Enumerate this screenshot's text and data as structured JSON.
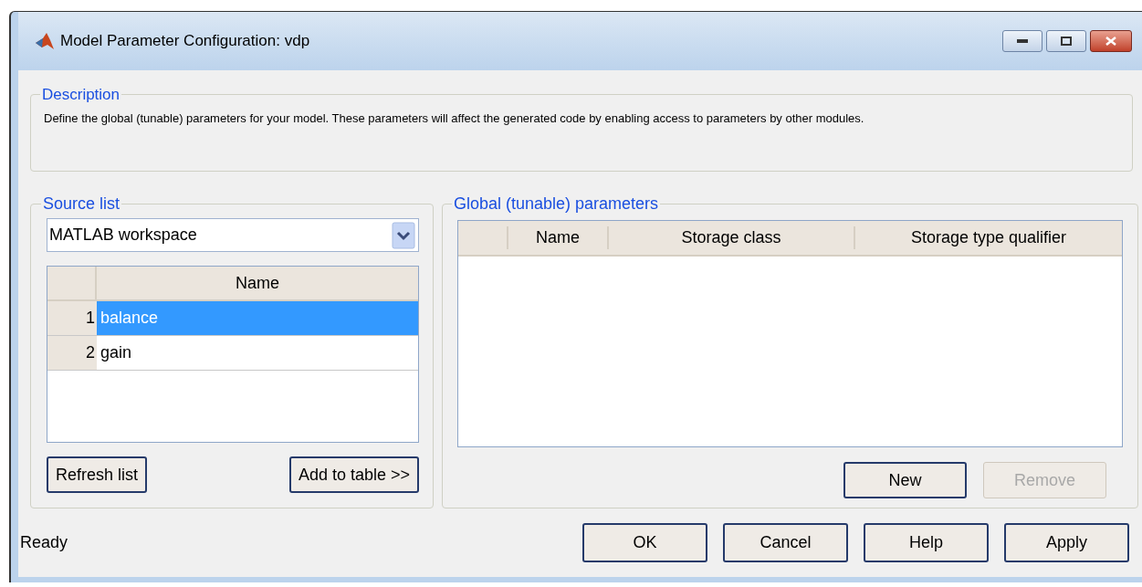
{
  "window": {
    "title": "Model Parameter Configuration: vdp"
  },
  "description": {
    "title": "Description",
    "text": "Define the global (tunable) parameters for your model. These parameters will affect the generated code by enabling access to parameters by other modules."
  },
  "source_list": {
    "title": "Source list",
    "source": "MATLAB workspace",
    "columns": [
      "Name"
    ],
    "rows": [
      {
        "index": "1",
        "name": "balance",
        "selected": true
      },
      {
        "index": "2",
        "name": "gain",
        "selected": false
      }
    ],
    "buttons": [
      {
        "label": "Refresh list",
        "disabled": false
      },
      {
        "label": "Add to table >>",
        "disabled": false
      }
    ]
  },
  "global_parameters": {
    "title": "Global (tunable) parameters",
    "columns": [
      "Name",
      "Storage class",
      "Storage type qualifier"
    ],
    "buttons": [
      {
        "label": "New",
        "disabled": false
      },
      {
        "label": "Remove",
        "disabled": true
      }
    ]
  },
  "status_bar": {
    "text": "Ready"
  },
  "dialog_buttons": [
    {
      "label": "OK",
      "disabled": false
    },
    {
      "label": "Cancel",
      "disabled": false
    },
    {
      "label": "Help",
      "disabled": false
    },
    {
      "label": "Apply",
      "disabled": false
    }
  ]
}
